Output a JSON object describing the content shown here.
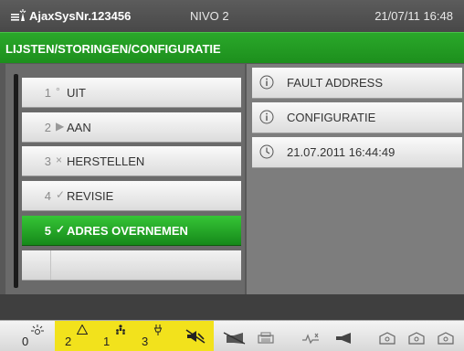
{
  "header": {
    "system_name": "AjaxSysNr.123456",
    "level": "NIVO 2",
    "datetime": "21/07/11 16:48"
  },
  "breadcrumb": "LIJSTEN/STORINGEN/CONFIGURATIE",
  "menu": {
    "items": [
      {
        "num": "1",
        "symbol": "°",
        "label": "UIT"
      },
      {
        "num": "2",
        "symbol": "▶",
        "label": "AAN"
      },
      {
        "num": "3",
        "symbol": "×",
        "label": "HERSTELLEN"
      },
      {
        "num": "4",
        "symbol": "✓",
        "label": "REVISIE"
      },
      {
        "num": "5",
        "symbol": "✓",
        "label": "ADRES OVERNEMEN"
      }
    ],
    "selected_index": 4
  },
  "info": {
    "rows": [
      {
        "icon": "info-icon",
        "text": "FAULT ADDRESS"
      },
      {
        "icon": "info-icon",
        "text": "CONFIGURATIE"
      },
      {
        "icon": "clock-icon",
        "text": "21.07.2011 16:44:49"
      }
    ]
  },
  "statusbar": {
    "counters": [
      {
        "name": "alarm",
        "value": "0",
        "highlight": false
      },
      {
        "name": "fault",
        "value": "2",
        "highlight": true
      },
      {
        "name": "fire",
        "value": "1",
        "highlight": true
      },
      {
        "name": "disable",
        "value": "3",
        "highlight": true
      }
    ],
    "colors": {
      "highlight": "#f2e21c",
      "accent_green": "#1d8f1d"
    }
  }
}
